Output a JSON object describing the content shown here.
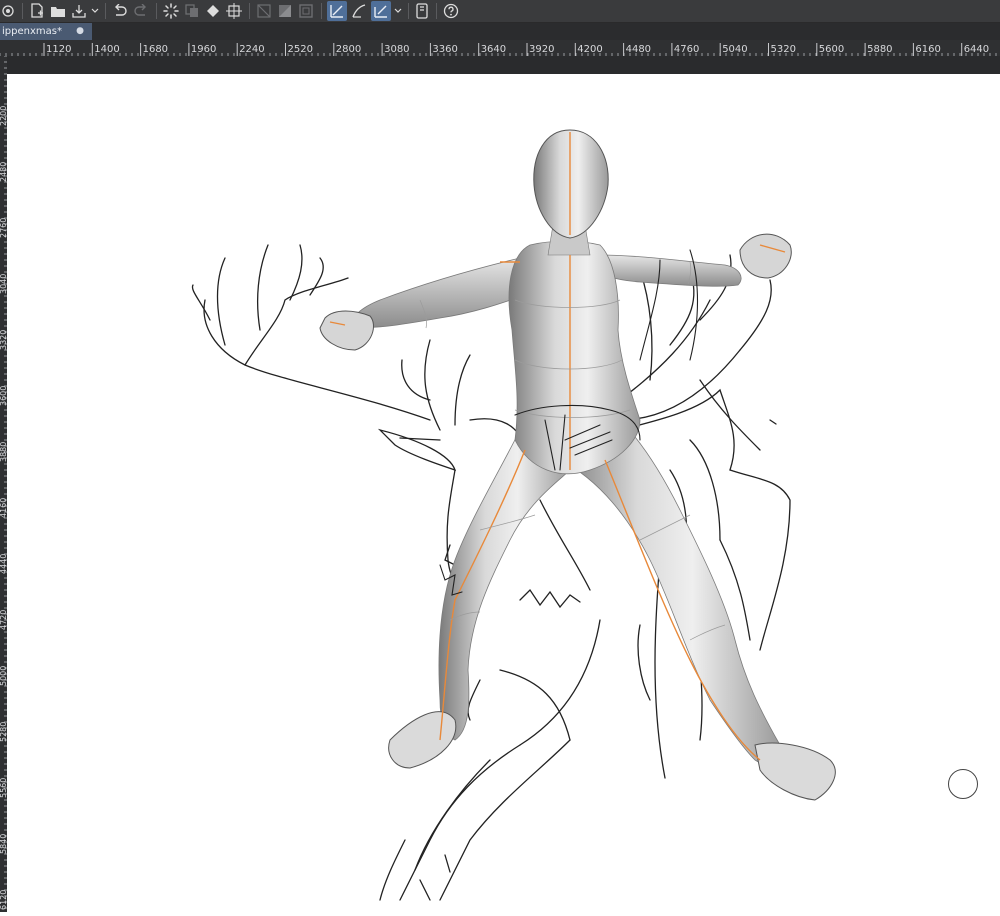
{
  "toolbar": {
    "buttons": [
      {
        "icon": "navigator-icon"
      },
      {
        "icon": "new-file-icon"
      },
      {
        "icon": "open-folder-icon"
      },
      {
        "icon": "export-icon"
      },
      {
        "icon": "export-dropdown-icon"
      },
      {
        "icon": "undo-icon"
      },
      {
        "icon": "redo-icon"
      },
      {
        "icon": "loading-spinner-icon"
      },
      {
        "icon": "copy-icon"
      },
      {
        "icon": "fill-bucket-icon"
      },
      {
        "icon": "transform-icon"
      },
      {
        "icon": "hide-selection-icon"
      },
      {
        "icon": "invert-icon"
      },
      {
        "icon": "border-icon"
      },
      {
        "icon": "snap-ruler-icon"
      },
      {
        "icon": "snap-special-ruler-icon"
      },
      {
        "icon": "snap-grid-icon"
      },
      {
        "icon": "snap-dropdown-icon"
      },
      {
        "icon": "device-icon"
      },
      {
        "icon": "help-icon"
      }
    ]
  },
  "document_tab": {
    "title": "ippenxmas*",
    "close_glyph": "●"
  },
  "ruler_top": {
    "labels": [
      "1120",
      "1400",
      "1680",
      "1960",
      "2240",
      "2520",
      "2800",
      "3080",
      "3360",
      "3640",
      "3920",
      "4200",
      "4480",
      "4760",
      "5040",
      "5320",
      "5600",
      "5880",
      "6160",
      "6440"
    ]
  },
  "ruler_left": {
    "labels": [
      "2200",
      "2480",
      "2760",
      "3040",
      "3320",
      "3600",
      "3880",
      "4160",
      "4440",
      "4720",
      "5000",
      "5280",
      "5560",
      "5840",
      "6120"
    ]
  },
  "colors": {
    "ui_dark": "#3a3b3d",
    "tab_active": "#4a5a72",
    "accent": "#4f6f99",
    "guide_orange": "#e8893a"
  }
}
